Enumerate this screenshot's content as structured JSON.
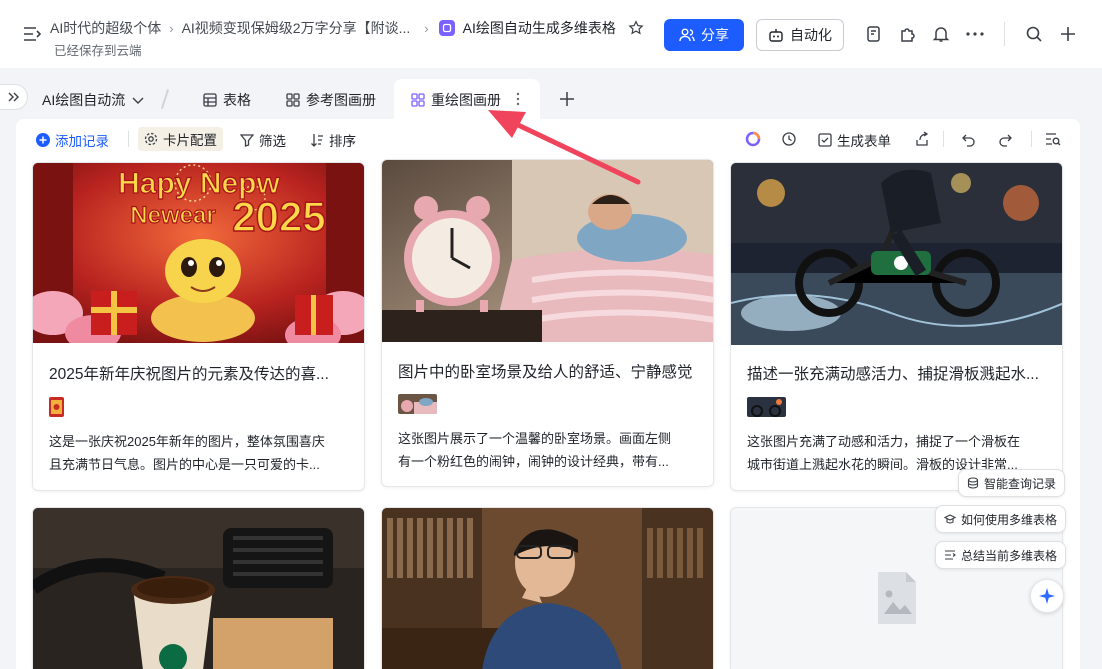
{
  "header": {
    "breadcrumbs": [
      "AI时代的超级个体",
      "AI视频变现保姆级2万字分享【附谈...",
      "AI绘图自动生成多维表格"
    ],
    "saved_status": "已经保存到云端",
    "share_label": "分享",
    "automation_label": "自动化"
  },
  "tabs": {
    "view_group": "AI绘图自动流",
    "items": [
      {
        "label": "表格",
        "icon": "grid-table-icon"
      },
      {
        "label": "参考图画册",
        "icon": "gallery-icon"
      },
      {
        "label": "重绘图画册",
        "icon": "gallery-icon"
      }
    ],
    "active_index": 2
  },
  "toolbar": {
    "add_record": "添加记录",
    "card_config": "卡片配置",
    "filter": "筛选",
    "sort": "排序",
    "generate_form": "生成表单"
  },
  "cards": [
    {
      "title": "2025年新年庆祝图片的元素及传达的喜...",
      "desc_line1": "这是一张庆祝2025年新年的图片，整体氛围喜庆",
      "desc_line2": "且充满节日气息。图片的中心是一只可爱的卡...",
      "image_text": "Hapy Nepw Newear 2025"
    },
    {
      "title": "图片中的卧室场景及给人的舒适、宁静感觉",
      "desc_line1": "这张图片展示了一个温馨的卧室场景。画面左侧",
      "desc_line2": "有一个粉红色的闹钟，闹钟的设计经典，带有..."
    },
    {
      "title": "描述一张充满动感活力、捕捉滑板溅起水...",
      "desc_line1": "这张图片充满了动感和活力，捕捉了一个滑板在",
      "desc_line2": "城市街道上溅起水花的瞬间。滑板的设计非常..."
    }
  ],
  "ai_chips": [
    "智能查询记录",
    "如何使用多维表格",
    "总结当前多维表格"
  ],
  "colors": {
    "accent": "#1d5cff",
    "active_tab_icon": "#7b61ff",
    "arrow": "#f0445c"
  }
}
